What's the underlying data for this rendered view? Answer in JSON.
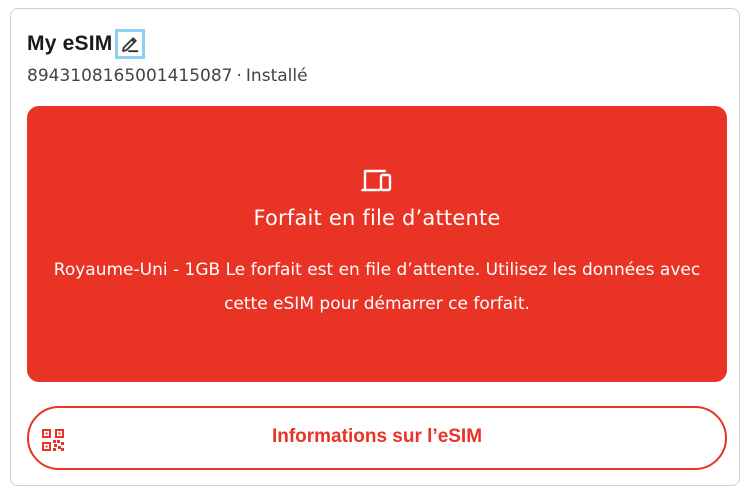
{
  "esim": {
    "title": "My eSIM",
    "iccid": "8943108165001415087",
    "separator": "·",
    "status": "Installé"
  },
  "banner": {
    "icon": "devices-icon",
    "title": "Forfait en file d’attente",
    "message": "Royaume-Uni - 1GB Le forfait est en file d’attente. Utilisez les données avec cette eSIM pour démarrer ce forfait.",
    "color": "#e93325"
  },
  "info_button": {
    "icon": "qr-code-icon",
    "label": "Informations sur l’eSIM"
  },
  "colors": {
    "accent": "#e93325",
    "focus_ring": "#8fd0f2"
  }
}
